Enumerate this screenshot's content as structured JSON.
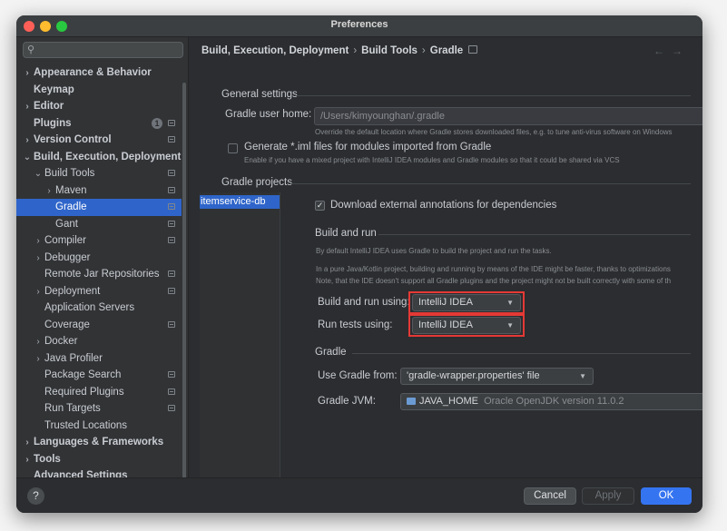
{
  "window": {
    "title": "Preferences"
  },
  "sidebar": {
    "search": {
      "value": "",
      "placeholder": ""
    },
    "items": [
      {
        "label": "Appearance & Behavior",
        "chevron": ">",
        "indent": 0,
        "bold": true
      },
      {
        "label": "Keymap",
        "chevron": "",
        "indent": 0,
        "bold": true
      },
      {
        "label": "Editor",
        "chevron": ">",
        "indent": 0,
        "bold": true
      },
      {
        "label": "Plugins",
        "chevron": "",
        "indent": 0,
        "bold": true,
        "badge": "1",
        "page_icon": true
      },
      {
        "label": "Version Control",
        "chevron": ">",
        "indent": 0,
        "bold": true,
        "page_icon": true
      },
      {
        "label": "Build, Execution, Deployment",
        "chevron": "v",
        "indent": 0,
        "bold": true
      },
      {
        "label": "Build Tools",
        "chevron": "v",
        "indent": 1,
        "page_icon": true
      },
      {
        "label": "Maven",
        "chevron": ">",
        "indent": 2,
        "page_icon": true
      },
      {
        "label": "Gradle",
        "chevron": "",
        "indent": 2,
        "selected": true,
        "page_icon": true
      },
      {
        "label": "Gant",
        "chevron": "",
        "indent": 2,
        "page_icon": true
      },
      {
        "label": "Compiler",
        "chevron": ">",
        "indent": 1,
        "page_icon": true
      },
      {
        "label": "Debugger",
        "chevron": ">",
        "indent": 1
      },
      {
        "label": "Remote Jar Repositories",
        "chevron": "",
        "indent": 1,
        "page_icon": true
      },
      {
        "label": "Deployment",
        "chevron": ">",
        "indent": 1,
        "page_icon": true
      },
      {
        "label": "Application Servers",
        "chevron": "",
        "indent": 1
      },
      {
        "label": "Coverage",
        "chevron": "",
        "indent": 1,
        "page_icon": true
      },
      {
        "label": "Docker",
        "chevron": ">",
        "indent": 1
      },
      {
        "label": "Java Profiler",
        "chevron": ">",
        "indent": 1
      },
      {
        "label": "Package Search",
        "chevron": "",
        "indent": 1,
        "page_icon": true
      },
      {
        "label": "Required Plugins",
        "chevron": "",
        "indent": 1,
        "page_icon": true
      },
      {
        "label": "Run Targets",
        "chevron": "",
        "indent": 1,
        "page_icon": true
      },
      {
        "label": "Trusted Locations",
        "chevron": "",
        "indent": 1
      },
      {
        "label": "Languages & Frameworks",
        "chevron": ">",
        "indent": 0,
        "bold": true
      },
      {
        "label": "Tools",
        "chevron": ">",
        "indent": 0,
        "bold": true
      },
      {
        "label": "Advanced Settings",
        "chevron": "",
        "indent": 0,
        "bold": true
      }
    ]
  },
  "breadcrumb": {
    "parts": [
      "Build, Execution, Deployment",
      "Build Tools",
      "Gradle"
    ],
    "separator": "›",
    "back": "←",
    "forward": "→"
  },
  "general": {
    "title": "General settings",
    "user_home_label": "Gradle user home:",
    "user_home_value": "/Users/kimyounghan/.gradle",
    "user_home_hint": "Override the default location where Gradle stores downloaded files, e.g. to tune anti-virus software on Windows",
    "generate_iml_label": "Generate *.iml files for modules imported from Gradle",
    "generate_iml_checked": false,
    "generate_iml_hint": "Enable if you have a mixed project with IntelliJ IDEA modules and Gradle modules so that it could be shared via VCS"
  },
  "projects": {
    "title": "Gradle projects",
    "list": [
      "itemservice-db"
    ],
    "download_annotations_label": "Download external annotations for dependencies",
    "download_annotations_checked": true
  },
  "build_run": {
    "title": "Build and run",
    "hint1": "By default IntelliJ IDEA uses Gradle to build the project and run the tasks.",
    "hint2": "In a pure Java/Kotlin project, building and running by means of the IDE might be faster, thanks to optimizations",
    "hint3": "Note, that the IDE doesn't support all Gradle plugins and the project might not be built correctly with some of th",
    "build_label": "Build and run using:",
    "build_value": "IntelliJ IDEA",
    "tests_label": "Run tests using:",
    "tests_value": "IntelliJ IDEA"
  },
  "gradle": {
    "title": "Gradle",
    "use_from_label": "Use Gradle from:",
    "use_from_value": "'gradle-wrapper.properties' file",
    "jvm_label": "Gradle JVM:",
    "jvm_value": "JAVA_HOME",
    "jvm_detail": "Oracle OpenJDK version 11.0.2"
  },
  "footer": {
    "help": "?",
    "cancel": "Cancel",
    "apply": "Apply",
    "ok": "OK"
  },
  "colors": {
    "selection": "#2f65ca",
    "ok_button": "#3574f0",
    "highlight_box": "#e53935"
  }
}
